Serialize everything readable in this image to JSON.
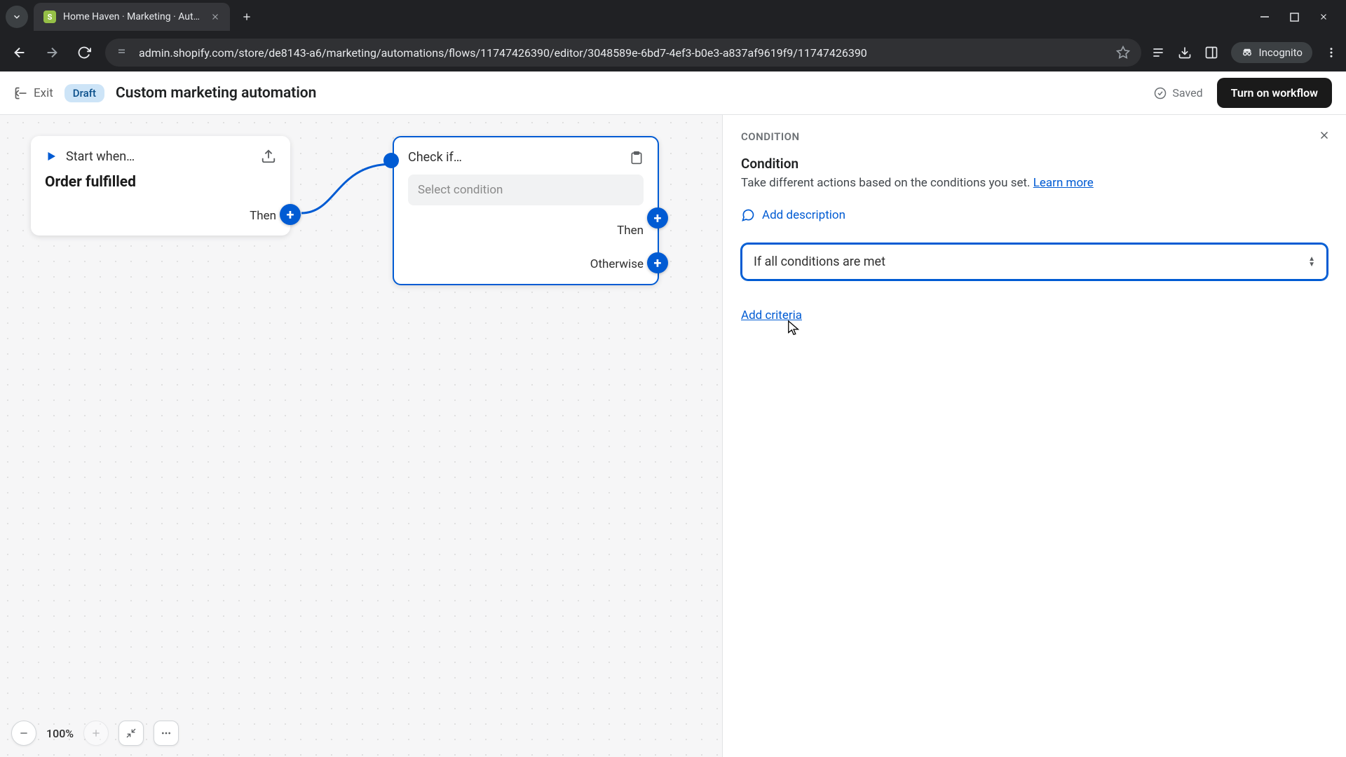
{
  "browser": {
    "tab_title": "Home Haven · Marketing · Aut…",
    "url": "admin.shopify.com/store/de8143-a6/marketing/automations/flows/11747426390/editor/3048589e-6bd7-4ef3-b0e3-a837af9619f9/11747426390",
    "incognito_label": "Incognito"
  },
  "header": {
    "exit_label": "Exit",
    "status_badge": "Draft",
    "title": "Custom marketing automation",
    "saved_label": "Saved",
    "primary_action": "Turn on workflow"
  },
  "canvas": {
    "start_node": {
      "heading": "Start when…",
      "trigger": "Order fulfilled",
      "then_label": "Then"
    },
    "check_node": {
      "heading": "Check if…",
      "placeholder": "Select condition",
      "then_label": "Then",
      "otherwise_label": "Otherwise"
    },
    "toolbar": {
      "zoom": "100%"
    }
  },
  "panel": {
    "section_label": "CONDITION",
    "title": "Condition",
    "description": "Take different actions based on the conditions you set. ",
    "learn_more": "Learn more",
    "add_description": "Add description",
    "condition_mode": "If all conditions are met",
    "add_criteria": "Add criteria"
  }
}
